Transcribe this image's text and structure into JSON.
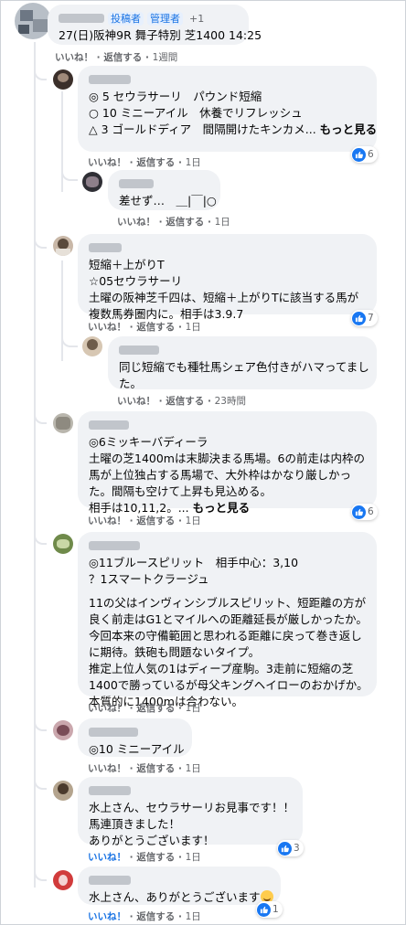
{
  "root": {
    "badges": [
      "投稿者",
      "管理者",
      "+1"
    ],
    "text": "27(日)阪神9R 舞子特別 芝1400 14:25",
    "like": "いいね！",
    "reply": "返信する",
    "time": "1週間"
  },
  "c1": {
    "lines": [
      "◎ 5 セウラサーリ　パウンド短縮",
      "○ 10 ミニーアイル　休養でリフレッシュ",
      "△ 3 ゴールドディア　間隔開けたキンカメ..."
    ],
    "more": "もっと見る",
    "like": "いいね！",
    "reply": "返信する",
    "time": "1日",
    "reactions": "6"
  },
  "c1r": {
    "text": "差せず…　＿|￣|○",
    "like": "いいね！",
    "reply": "返信する",
    "time": "1日"
  },
  "c2": {
    "lines": [
      "短縮＋上がりT",
      "☆05セウラサーリ",
      "土曜の阪神芝千四は、短縮＋上がりTに該当する馬が",
      "複数馬券圏内に。相手は3.9.7"
    ],
    "like": "いいね！",
    "reply": "返信する",
    "time": "1日",
    "reactions": "7"
  },
  "c2r": {
    "lines": [
      "同じ短縮でも種牡馬シェア色付きがハマってまし",
      "た。"
    ],
    "like": "いいね！",
    "reply": "返信する",
    "time": "23時間"
  },
  "c3": {
    "lines": [
      "◎6ミッキーバディーラ",
      "土曜の芝1400mは末脚決まる馬場。6の前走は内枠の",
      "馬が上位独占する馬場で、大外枠はかなり厳しかっ",
      "た。間隔も空けて上昇も見込める。",
      "相手は10,11,2。..."
    ],
    "more": "もっと見る",
    "like": "いいね！",
    "reply": "返信する",
    "time": "1日",
    "reactions": "6"
  },
  "c4": {
    "lines": [
      "◎11ブルースピリット　相手中心：3,10",
      "？1スマートクラージュ"
    ],
    "para": [
      "11の父はインヴィンシブルスピリット、短距離の方が",
      "良く前走はG1とマイルへの距離延長が厳しかったか。",
      "今回本来の守備範囲と思われる距離に戻って巻き返し",
      "に期待。鉄砲も問題ないタイプ。",
      "推定上位人気の1はディープ産駒。3走前に短縮の芝",
      "1400で勝っているが母父キングヘイローのおかげか。",
      "本質的に1400mは合わない。"
    ],
    "like": "いいね！",
    "reply": "返信する",
    "time": "1日"
  },
  "c5": {
    "text": "◎10 ミニーアイル",
    "like": "いいね！",
    "reply": "返信する",
    "time": "1日"
  },
  "c6": {
    "lines": [
      "水上さん、セウラサーリお見事です！！",
      "馬連頂きました！",
      "ありがとうございます！"
    ],
    "like": "いいね！",
    "reply": "返信する",
    "time": "1日",
    "reactions": "3"
  },
  "c7": {
    "text": "水上さん、ありがとうございます",
    "like": "いいね！",
    "reply": "返信する",
    "time": "1日",
    "reactions": "1"
  },
  "colors": {
    "accent": "#1877f2",
    "bubble": "#f0f2f5",
    "meta": "#65676b"
  },
  "icons": {
    "reaction": "thumbs-up-icon",
    "emoji": "smiling-face-icon"
  }
}
